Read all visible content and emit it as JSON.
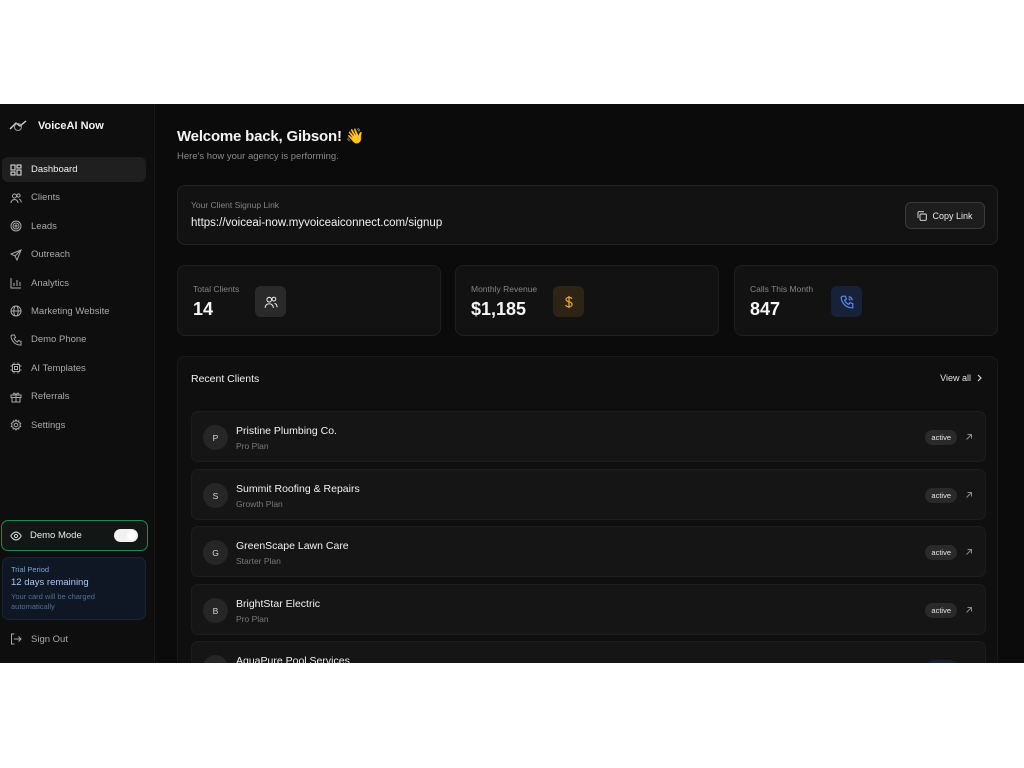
{
  "brand": {
    "name": "VoiceAI Now"
  },
  "nav": [
    {
      "label": "Dashboard",
      "icon": "dashboard-icon",
      "active": true
    },
    {
      "label": "Clients",
      "icon": "users-icon"
    },
    {
      "label": "Leads",
      "icon": "target-icon"
    },
    {
      "label": "Outreach",
      "icon": "send-icon"
    },
    {
      "label": "Analytics",
      "icon": "bar-chart-icon"
    },
    {
      "label": "Marketing Website",
      "icon": "globe-icon"
    },
    {
      "label": "Demo Phone",
      "icon": "phone-icon"
    },
    {
      "label": "AI Templates",
      "icon": "cpu-icon"
    },
    {
      "label": "Referrals",
      "icon": "gift-icon"
    },
    {
      "label": "Settings",
      "icon": "gear-icon"
    }
  ],
  "demo_mode": {
    "label": "Demo Mode",
    "enabled": true
  },
  "trial": {
    "label": "Trial Period",
    "days": "12 days remaining",
    "note": "Your card will be charged automatically"
  },
  "signout": "Sign Out",
  "header": {
    "welcome": "Welcome back, Gibson! 👋",
    "subtitle": "Here's how your agency is performing."
  },
  "signup": {
    "label": "Your Client Signup Link",
    "url": "https://voiceai-now.myvoiceaiconnect.com/signup",
    "copy_label": "Copy Link"
  },
  "stats": [
    {
      "label": "Total Clients",
      "value": "14",
      "icon": "users-icon",
      "color": "#2a2a2a"
    },
    {
      "label": "Monthly Revenue",
      "value": "$1,185",
      "icon": "dollar-icon",
      "color": "#2e2416"
    },
    {
      "label": "Calls This Month",
      "value": "847",
      "icon": "phone-call-icon",
      "color": "#172238"
    }
  ],
  "recent": {
    "title": "Recent Clients",
    "view_all": "View all",
    "clients": [
      {
        "initial": "P",
        "name": "Pristine Plumbing Co.",
        "plan": "Pro Plan",
        "status": "active"
      },
      {
        "initial": "S",
        "name": "Summit Roofing & Repairs",
        "plan": "Growth Plan",
        "status": "active"
      },
      {
        "initial": "G",
        "name": "GreenScape Lawn Care",
        "plan": "Starter Plan",
        "status": "active"
      },
      {
        "initial": "B",
        "name": "BrightStar Electric",
        "plan": "Pro Plan",
        "status": "active"
      },
      {
        "initial": "",
        "name": "AquaPure Pool Services",
        "plan": "",
        "status": ""
      }
    ]
  }
}
